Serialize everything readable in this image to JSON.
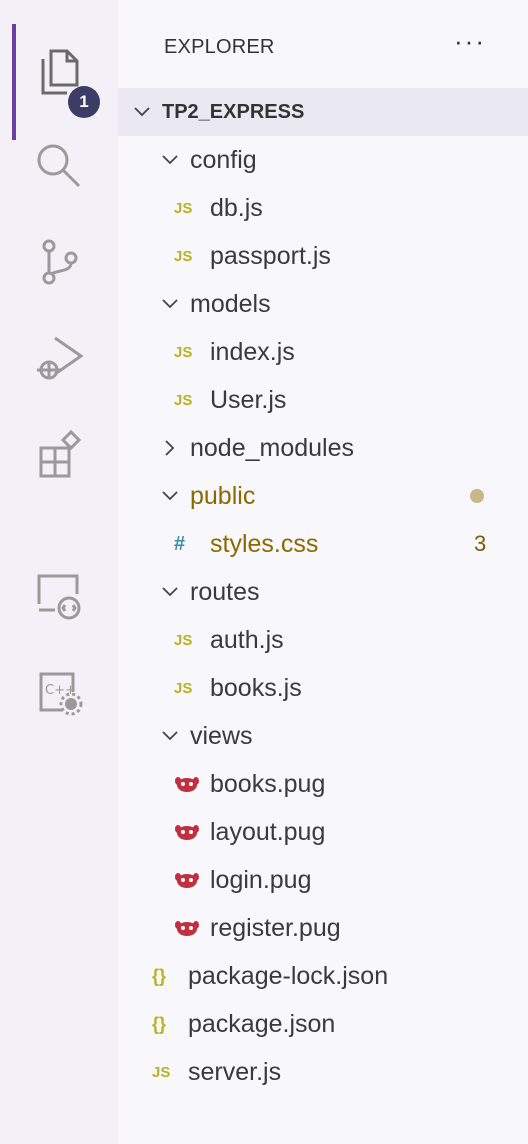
{
  "explorer": {
    "title": "EXPLORER",
    "more": "···",
    "badge_count": "1"
  },
  "activity_bar": [
    {
      "name": "explorer",
      "icon": "files-icon"
    },
    {
      "name": "search",
      "icon": "search-icon"
    },
    {
      "name": "source-control",
      "icon": "source-control-icon"
    },
    {
      "name": "run-debug",
      "icon": "run-debug-icon"
    },
    {
      "name": "extensions",
      "icon": "extensions-icon"
    },
    {
      "name": "remote-explorer",
      "icon": "remote-explorer-icon"
    },
    {
      "name": "cpp-tools",
      "icon": "cpp-settings-icon"
    }
  ],
  "tree": {
    "root": "TP2_EXPRESS",
    "items": [
      {
        "label": "config",
        "kind": "folder"
      },
      {
        "label": "db.js",
        "kind": "js",
        "icon_text": "JS"
      },
      {
        "label": "passport.js",
        "kind": "js",
        "icon_text": "JS"
      },
      {
        "label": "models",
        "kind": "folder"
      },
      {
        "label": "index.js",
        "kind": "js",
        "icon_text": "JS"
      },
      {
        "label": "User.js",
        "kind": "js",
        "icon_text": "JS"
      },
      {
        "label": "node_modules",
        "kind": "folder-collapsed"
      },
      {
        "label": "public",
        "kind": "folder"
      },
      {
        "label": "styles.css",
        "kind": "css",
        "icon_text": "#",
        "problems": "3"
      },
      {
        "label": "routes",
        "kind": "folder"
      },
      {
        "label": "auth.js",
        "kind": "js",
        "icon_text": "JS"
      },
      {
        "label": "books.js",
        "kind": "js",
        "icon_text": "JS"
      },
      {
        "label": "views",
        "kind": "folder"
      },
      {
        "label": "books.pug",
        "kind": "pug"
      },
      {
        "label": "layout.pug",
        "kind": "pug"
      },
      {
        "label": "login.pug",
        "kind": "pug"
      },
      {
        "label": "register.pug",
        "kind": "pug"
      },
      {
        "label": "package-lock.json",
        "kind": "json",
        "icon_text": "{}"
      },
      {
        "label": "package.json",
        "kind": "json",
        "icon_text": "{}"
      },
      {
        "label": "server.js",
        "kind": "js",
        "icon_text": "JS"
      }
    ]
  },
  "colors": {
    "accent": "#6b3fa0",
    "js_icon": "#b7b320",
    "css_icon": "#3b8eaf",
    "pug_icon": "#c0303e",
    "modified_text": "#8a6a00"
  }
}
